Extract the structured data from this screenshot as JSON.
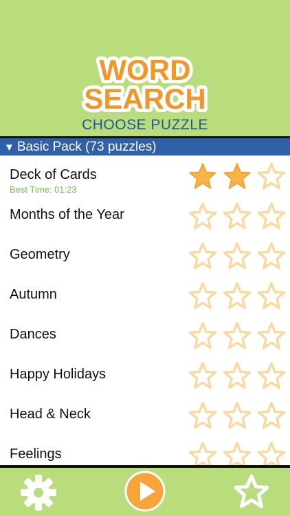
{
  "logo": {
    "line1": "WORD",
    "line2": "SEARCH"
  },
  "title": "CHOOSE PUZZLE",
  "pack": {
    "label": "Basic Pack  (73 puzzles)"
  },
  "puzzles": [
    {
      "name": "Deck of Cards",
      "best_time": "Best Time: 01:23",
      "stars_earned": 2
    },
    {
      "name": "Months of the Year",
      "stars_earned": 0
    },
    {
      "name": "Geometry",
      "stars_earned": 0
    },
    {
      "name": "Autumn",
      "stars_earned": 0
    },
    {
      "name": "Dances",
      "stars_earned": 0
    },
    {
      "name": "Happy Holidays",
      "stars_earned": 0
    },
    {
      "name": "Head & Neck",
      "stars_earned": 0
    },
    {
      "name": "Feelings",
      "stars_earned": 0
    }
  ],
  "footer": {
    "settings_icon": "gear-icon",
    "play_icon": "play-icon",
    "favorites_icon": "star-icon"
  },
  "colors": {
    "background": "#b9dd7d",
    "logo_orange": "#f0962a",
    "title_blue": "#1e5a97",
    "pack_blue": "#3060a8",
    "best_time_green": "#6cc44a",
    "star_filled": "#f7b548",
    "star_empty_outline": "#f9d9a0"
  }
}
